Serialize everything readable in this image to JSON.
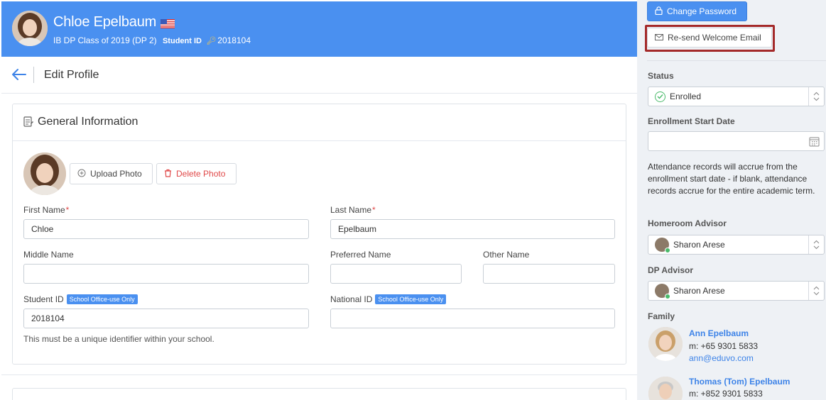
{
  "header": {
    "student_name": "Chloe Epelbaum",
    "class_text": "IB DP Class of 2019 (DP 2)",
    "student_id_label": "Student ID",
    "student_id_value": "2018104"
  },
  "edit_bar": {
    "title": "Edit Profile"
  },
  "general": {
    "title": "General Information",
    "upload_label": "Upload Photo",
    "delete_label": "Delete Photo",
    "first_name_label": "First Name",
    "first_name_value": "Chloe",
    "last_name_label": "Last Name",
    "last_name_value": "Epelbaum",
    "middle_name_label": "Middle Name",
    "middle_name_value": "",
    "preferred_name_label": "Preferred Name",
    "preferred_name_value": "",
    "other_name_label": "Other Name",
    "other_name_value": "",
    "student_id_label": "Student ID",
    "student_id_value": "2018104",
    "national_id_label": "National ID",
    "national_id_value": "",
    "office_badge": "School Office-use Only",
    "required_mark": "*",
    "student_id_help": "This must be a unique identifier within your school."
  },
  "sidebar": {
    "change_password": "Change Password",
    "resend_welcome": "Re-send Welcome Email",
    "status_label": "Status",
    "status_value": "Enrolled",
    "enroll_start_label": "Enrollment Start Date",
    "enroll_start_value": "",
    "attendance_note": "Attendance records will accrue from the enrollment start date - if blank, attendance records accrue for the entire academic term.",
    "homeroom_label": "Homeroom Advisor",
    "homeroom_value": "Sharon Arese",
    "dp_advisor_label": "DP Advisor",
    "dp_advisor_value": "Sharon Arese",
    "family_label": "Family",
    "family": [
      {
        "name": "Ann Epelbaum",
        "mobile": "m: +65 9301 5833",
        "email": "ann@eduvo.com"
      },
      {
        "name": "Thomas (Tom) Epelbaum",
        "mobile": "m: +852 9301 5833"
      }
    ]
  },
  "colors": {
    "accent": "#4a90f0",
    "danger": "#e04848",
    "success": "#4aba6a",
    "highlight_border": "#a42a2a"
  },
  "icons": [
    "back-arrow-icon",
    "us-flag-icon",
    "key-icon",
    "document-icon",
    "plus-circle-icon",
    "trash-icon",
    "lock-icon",
    "envelope-icon",
    "check-circle-icon",
    "calendar-icon",
    "chevron-updown-icon"
  ]
}
